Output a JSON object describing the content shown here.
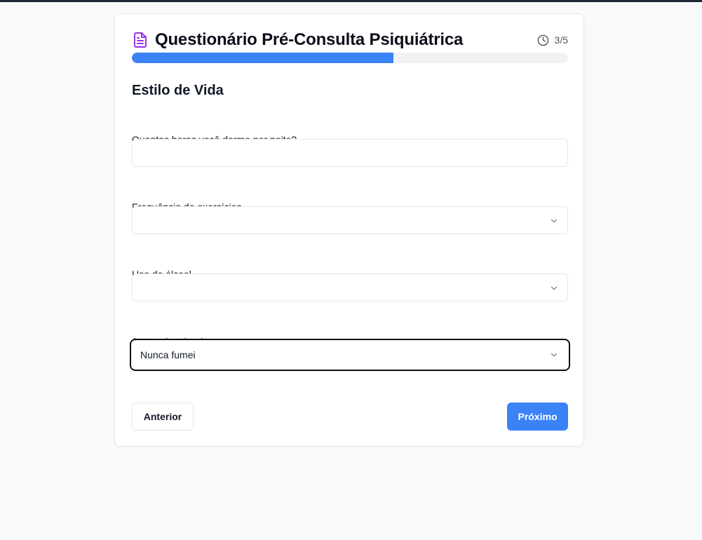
{
  "app": {
    "title": "Questionário Pré-Consulta Psiquiátrica",
    "icon": "document-text-icon",
    "accent_color": "#3b82f6",
    "title_icon_color": "#9333ea"
  },
  "progress": {
    "step_text": "3/5",
    "current_step": 3,
    "total_steps": 5,
    "fraction": 0.6,
    "icon": "clock-icon"
  },
  "section": {
    "title": "Estilo de Vida"
  },
  "fields": {
    "sleep": {
      "label": "Quantas horas você dorme por noite?",
      "value": "",
      "placeholder": ""
    },
    "exercise": {
      "label": "Frequência de exercícios",
      "selected": ""
    },
    "alcohol": {
      "label": "Uso de álcool",
      "selected": ""
    },
    "smoking": {
      "label": "Status de tabagismo",
      "selected": "Nunca fumei"
    }
  },
  "buttons": {
    "back_label": "Anterior",
    "next_label": "Próximo"
  }
}
